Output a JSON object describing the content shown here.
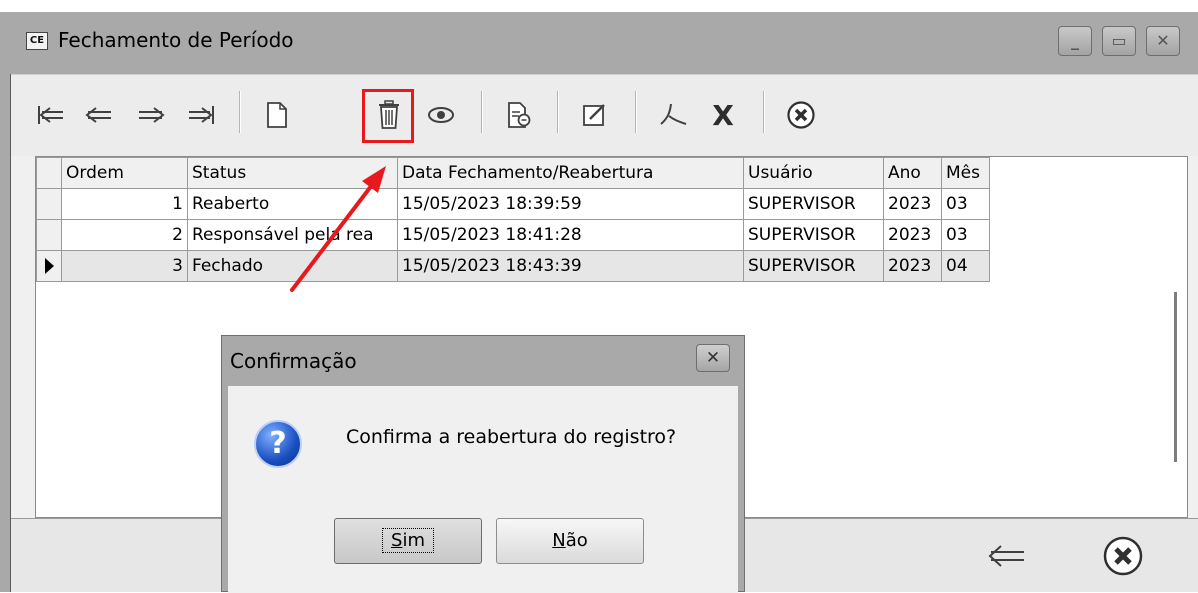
{
  "window": {
    "title": "Fechamento de Período",
    "app_badge": "CE",
    "controls": [
      "minimize",
      "maximize",
      "close"
    ]
  },
  "toolbar": {
    "buttons": [
      {
        "name": "first-record",
        "icon": "first-icon"
      },
      {
        "name": "previous-record",
        "icon": "previous-icon"
      },
      {
        "name": "next-record",
        "icon": "next-icon"
      },
      {
        "name": "last-record",
        "icon": "last-icon"
      },
      {
        "name": "new",
        "icon": "new-document-icon"
      },
      {
        "name": "delete",
        "icon": "trash-icon",
        "highlighted": true
      },
      {
        "name": "view",
        "icon": "eye-icon"
      },
      {
        "name": "report",
        "icon": "report-icon"
      },
      {
        "name": "edit",
        "icon": "edit-icon"
      },
      {
        "name": "pdf",
        "icon": "pdf-icon"
      },
      {
        "name": "excel",
        "icon": "excel-x-icon",
        "glyph": "X"
      },
      {
        "name": "close",
        "icon": "close-circle-icon"
      }
    ],
    "highlight_color": "#e8191d"
  },
  "grid": {
    "columns": [
      "Ordem",
      "Status",
      "Data Fechamento/Reabertura",
      "Usuário",
      "Ano",
      "Mês"
    ],
    "rows": [
      {
        "ordem": "1",
        "status": "Reaberto",
        "data": "15/05/2023 18:39:59",
        "usuario": "SUPERVISOR",
        "ano": "2023",
        "mes": "03",
        "selected": false
      },
      {
        "ordem": "2",
        "status": "Responsável pela rea",
        "data": "15/05/2023 18:41:28",
        "usuario": "SUPERVISOR",
        "ano": "2023",
        "mes": "03",
        "selected": false
      },
      {
        "ordem": "3",
        "status": "Fechado",
        "data": "15/05/2023 18:43:39",
        "usuario": "SUPERVISOR",
        "ano": "2023",
        "mes": "04",
        "selected": true
      }
    ]
  },
  "statusbar": {
    "buttons": [
      {
        "name": "back",
        "icon": "back-arrow-icon"
      },
      {
        "name": "close",
        "icon": "close-circle-icon"
      }
    ]
  },
  "dialog": {
    "title": "Confirmação",
    "message": "Confirma a reabertura do registro?",
    "icon": "question-icon",
    "yes_label": "Sim",
    "yes_mnemonic": "S",
    "yes_rest": "im",
    "no_label": "Não",
    "no_mnemonic": "N",
    "no_rest": "ão"
  },
  "annotation": {
    "arrow_color": "#e8191d"
  }
}
